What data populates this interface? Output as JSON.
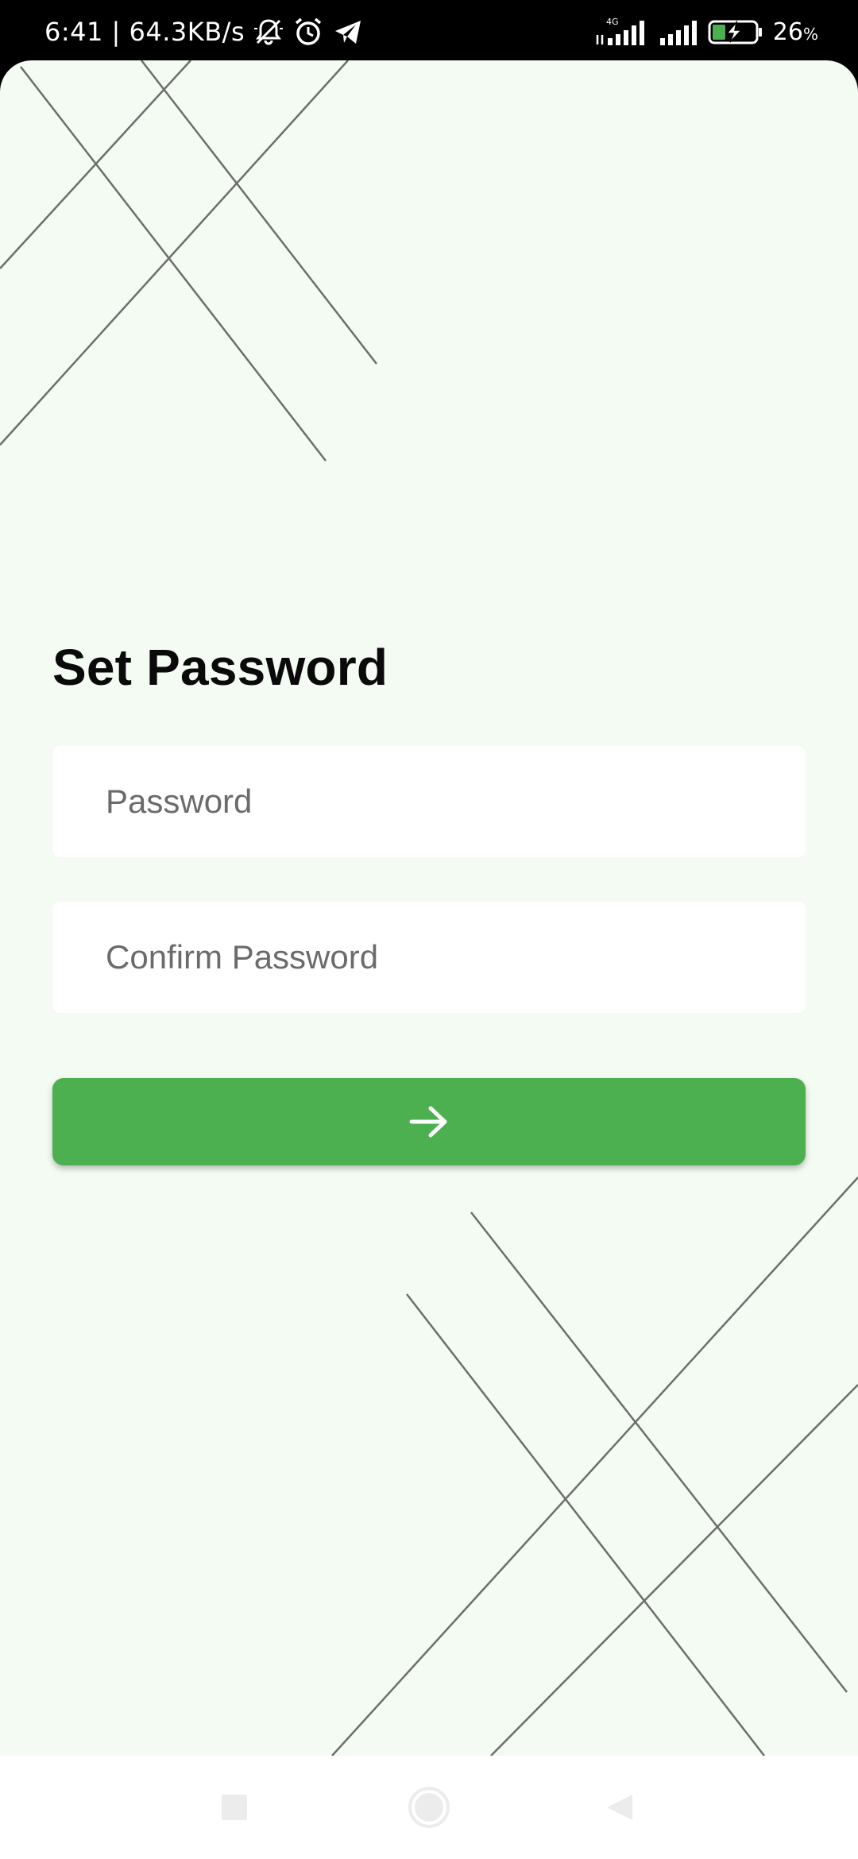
{
  "status_bar": {
    "time": "6:41",
    "network_speed": "64.3KB/s",
    "battery_percent": "26",
    "battery_unit": "%",
    "network_type": "4G",
    "icons": [
      "mute-icon",
      "alarm-icon",
      "telegram-icon",
      "signal-icon",
      "signal-icon",
      "battery-charging-icon"
    ]
  },
  "screen": {
    "title": "Set Password",
    "password_placeholder": "Password",
    "confirm_placeholder": "Confirm Password",
    "submit_icon": "arrow-right-icon"
  },
  "navigation": {
    "icons": [
      "recents-icon",
      "home-icon",
      "back-icon"
    ]
  },
  "colors": {
    "background": "#f3fbf2",
    "accent": "#4caf50",
    "field": "#ffffff",
    "line": "#6e6e6e"
  }
}
